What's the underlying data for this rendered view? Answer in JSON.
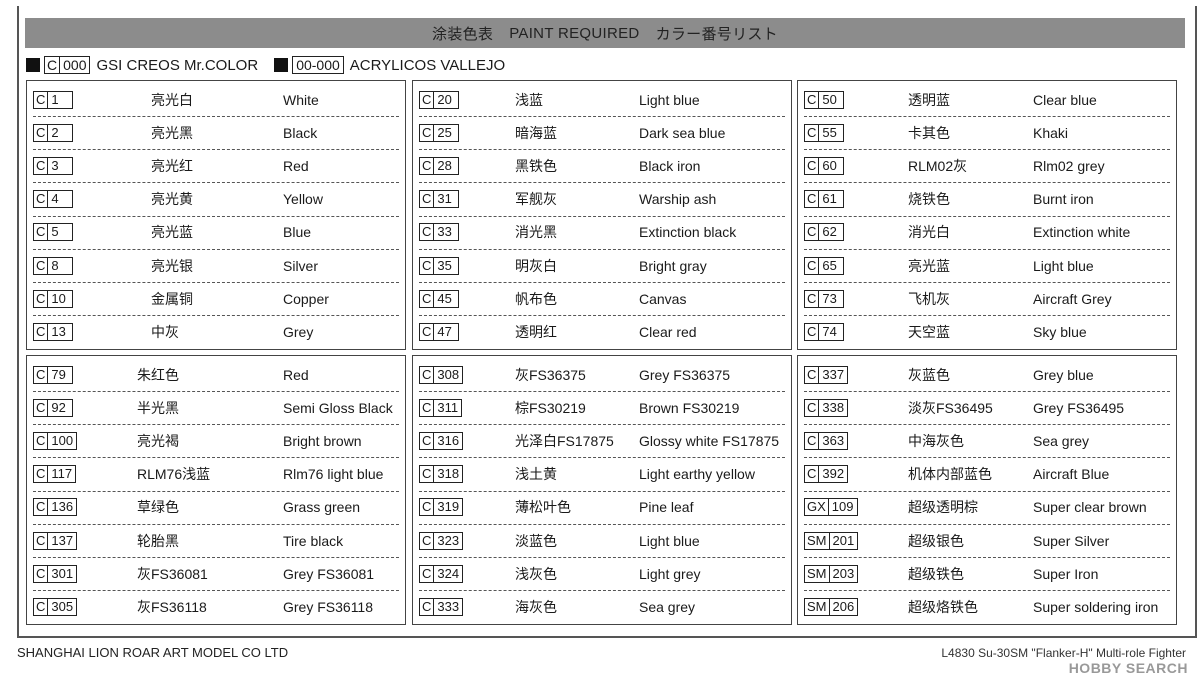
{
  "header": {
    "cn": "涂装色表",
    "en": "PAINT REQUIRED",
    "jp": "カラー番号リスト"
  },
  "legend": {
    "gsi_prefix": "C",
    "gsi_num": "000",
    "gsi_label": "GSI CREOS Mr.COLOR",
    "vallejo_code": "00-000",
    "vallejo_label": "ACRYLICOS VALLEJO"
  },
  "box1": [
    {
      "p": "C",
      "n": "1",
      "cn": "亮光白",
      "en": "White"
    },
    {
      "p": "C",
      "n": "2",
      "cn": "亮光黑",
      "en": "Black"
    },
    {
      "p": "C",
      "n": "3",
      "cn": "亮光红",
      "en": "Red"
    },
    {
      "p": "C",
      "n": "4",
      "cn": "亮光黄",
      "en": "Yellow"
    },
    {
      "p": "C",
      "n": "5",
      "cn": "亮光蓝",
      "en": "Blue"
    },
    {
      "p": "C",
      "n": "8",
      "cn": "亮光银",
      "en": "Silver"
    },
    {
      "p": "C",
      "n": "10",
      "cn": "金属铜",
      "en": "Copper"
    },
    {
      "p": "C",
      "n": "13",
      "cn": "中灰",
      "en": "Grey"
    }
  ],
  "box2": [
    {
      "p": "C",
      "n": "20",
      "cn": "浅蓝",
      "en": "Light blue"
    },
    {
      "p": "C",
      "n": "25",
      "cn": "暗海蓝",
      "en": "Dark sea blue"
    },
    {
      "p": "C",
      "n": "28",
      "cn": "黑铁色",
      "en": "Black iron"
    },
    {
      "p": "C",
      "n": "31",
      "cn": "军舰灰",
      "en": "Warship ash"
    },
    {
      "p": "C",
      "n": "33",
      "cn": "消光黑",
      "en": "Extinction black"
    },
    {
      "p": "C",
      "n": "35",
      "cn": "明灰白",
      "en": "Bright gray"
    },
    {
      "p": "C",
      "n": "45",
      "cn": "帆布色",
      "en": "Canvas"
    },
    {
      "p": "C",
      "n": "47",
      "cn": "透明红",
      "en": "Clear red"
    }
  ],
  "box3": [
    {
      "p": "C",
      "n": "50",
      "cn": "透明蓝",
      "en": "Clear blue"
    },
    {
      "p": "C",
      "n": "55",
      "cn": "卡其色",
      "en": "Khaki"
    },
    {
      "p": "C",
      "n": "60",
      "cn": "RLM02灰",
      "en": "Rlm02 grey"
    },
    {
      "p": "C",
      "n": "61",
      "cn": "烧铁色",
      "en": "Burnt iron"
    },
    {
      "p": "C",
      "n": "62",
      "cn": "消光白",
      "en": "Extinction white"
    },
    {
      "p": "C",
      "n": "65",
      "cn": "亮光蓝",
      "en": "Light blue"
    },
    {
      "p": "C",
      "n": "73",
      "cn": "飞机灰",
      "en": "Aircraft Grey"
    },
    {
      "p": "C",
      "n": "74",
      "cn": "天空蓝",
      "en": "Sky blue"
    }
  ],
  "box4": [
    {
      "p": "C",
      "n": "79",
      "cn": "朱红色",
      "en": "Red"
    },
    {
      "p": "C",
      "n": "92",
      "cn": "半光黑",
      "en": "Semi Gloss Black"
    },
    {
      "p": "C",
      "n": "100",
      "cn": "亮光褐",
      "en": "Bright brown"
    },
    {
      "p": "C",
      "n": "117",
      "cn": "RLM76浅蓝",
      "en": "Rlm76 light blue"
    },
    {
      "p": "C",
      "n": "136",
      "cn": "草绿色",
      "en": "Grass green"
    },
    {
      "p": "C",
      "n": "137",
      "cn": "轮胎黑",
      "en": "Tire black"
    },
    {
      "p": "C",
      "n": "301",
      "cn": "灰FS36081",
      "en": "Grey FS36081"
    },
    {
      "p": "C",
      "n": "305",
      "cn": "灰FS36118",
      "en": "Grey FS36118"
    }
  ],
  "box5": [
    {
      "p": "C",
      "n": "308",
      "cn": "灰FS36375",
      "en": "Grey FS36375"
    },
    {
      "p": "C",
      "n": "311",
      "cn": "棕FS30219",
      "en": "Brown FS30219"
    },
    {
      "p": "C",
      "n": "316",
      "cn": "光泽白FS17875",
      "en": "Glossy white FS17875"
    },
    {
      "p": "C",
      "n": "318",
      "cn": "浅土黄",
      "en": "Light earthy yellow"
    },
    {
      "p": "C",
      "n": "319",
      "cn": "薄松叶色",
      "en": "Pine leaf"
    },
    {
      "p": "C",
      "n": "323",
      "cn": "淡蓝色",
      "en": "Light blue"
    },
    {
      "p": "C",
      "n": "324",
      "cn": "浅灰色",
      "en": "Light grey"
    },
    {
      "p": "C",
      "n": "333",
      "cn": "海灰色",
      "en": "Sea grey"
    }
  ],
  "box6": [
    {
      "p": "C",
      "n": "337",
      "cn": "灰蓝色",
      "en": "Grey blue"
    },
    {
      "p": "C",
      "n": "338",
      "cn": "淡灰FS36495",
      "en": "Grey FS36495"
    },
    {
      "p": "C",
      "n": "363",
      "cn": "中海灰色",
      "en": "Sea grey"
    },
    {
      "p": "C",
      "n": "392",
      "cn": "机体内部蓝色",
      "en": "Aircraft Blue"
    },
    {
      "p": "GX",
      "n": "109",
      "cn": "超级透明棕",
      "en": "Super clear brown"
    },
    {
      "p": "SM",
      "n": "201",
      "cn": "超级银色",
      "en": "Super Silver"
    },
    {
      "p": "SM",
      "n": "203",
      "cn": "超级铁色",
      "en": "Super Iron"
    },
    {
      "p": "SM",
      "n": "206",
      "cn": "超级烙铁色",
      "en": "Super soldering iron"
    }
  ],
  "footer": {
    "company": "SHANGHAI LION ROAR ART MODEL CO LTD",
    "product": "L4830 Su-30SM \"Flanker-H\" Multi-role Fighter",
    "watermark": "HOBBY SEARCH"
  }
}
